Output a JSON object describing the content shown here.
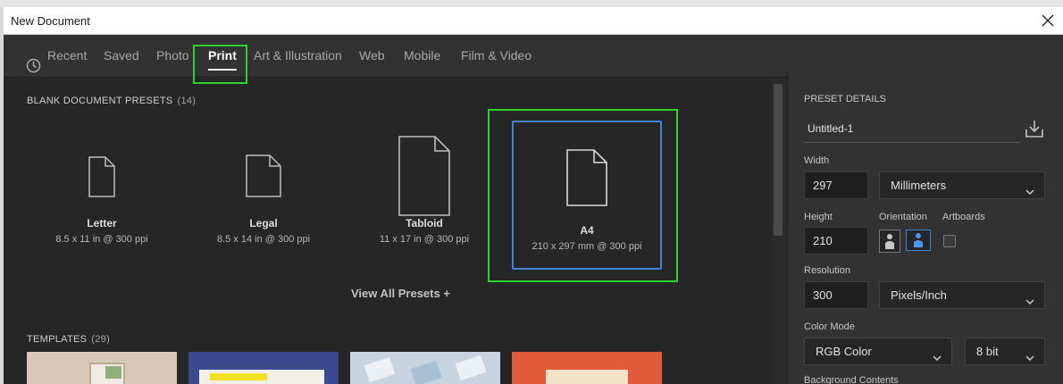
{
  "dialog": {
    "title": "New Document"
  },
  "tabs": [
    {
      "label": "Recent"
    },
    {
      "label": "Saved"
    },
    {
      "label": "Photo"
    },
    {
      "label": "Print"
    },
    {
      "label": "Art & Illustration"
    },
    {
      "label": "Web"
    },
    {
      "label": "Mobile"
    },
    {
      "label": "Film & Video"
    }
  ],
  "active_tab": "Print",
  "presets_section": {
    "label": "BLANK DOCUMENT PRESETS",
    "count": "(14)"
  },
  "presets": [
    {
      "name": "Letter",
      "desc": "8.5 x 11 in @ 300 ppi"
    },
    {
      "name": "Legal",
      "desc": "8.5 x 14 in @ 300 ppi"
    },
    {
      "name": "Tabloid",
      "desc": "11 x 17 in @ 300 ppi"
    },
    {
      "name": "A4",
      "desc": "210 x 297 mm @ 300 ppi"
    }
  ],
  "selected_preset": "A4",
  "view_all": "View All Presets +",
  "templates_section": {
    "label": "TEMPLATES",
    "count": "(29)"
  },
  "details": {
    "header": "PRESET DETAILS",
    "doc_name": "Untitled-1",
    "width_label": "Width",
    "width_value": "297",
    "width_unit": "Millimeters",
    "height_label": "Height",
    "height_value": "210",
    "orientation_label": "Orientation",
    "artboards_label": "Artboards",
    "resolution_label": "Resolution",
    "resolution_value": "300",
    "resolution_unit": "Pixels/Inch",
    "color_mode_label": "Color Mode",
    "color_mode": "RGB Color",
    "bit_depth": "8 bit",
    "background_label": "Background Contents"
  },
  "icons": {
    "close": "close-icon",
    "recent": "clock-icon",
    "save_preset": "save-preset-icon",
    "portrait": "portrait-orientation-icon",
    "landscape": "landscape-orientation-icon",
    "chevron": "chevron-down-icon",
    "document": "document-icon"
  },
  "colors": {
    "accent": "#3e84dc",
    "highlight": "#2bd42b",
    "background": "#262626",
    "panel": "#323232"
  }
}
